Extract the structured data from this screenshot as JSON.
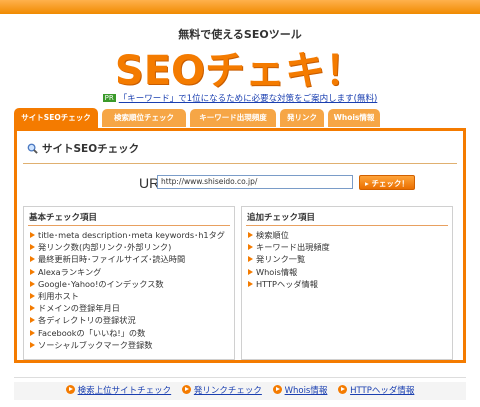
{
  "header": {
    "tagline": "無料で使えるSEOツール",
    "logo_text": "SEOチェキ！"
  },
  "notice": {
    "badge": "PR",
    "text": "「キーワード」で1位になるために必要な対策をご案内します(無料)"
  },
  "tabs": [
    {
      "label": "サイトSEOチェック",
      "active": true
    },
    {
      "label": "検索順位チェック",
      "active": false
    },
    {
      "label": "キーワード出現頻度",
      "active": false
    },
    {
      "label": "発リンク",
      "active": false
    },
    {
      "label": "Whois情報",
      "active": false
    }
  ],
  "panel": {
    "title": "サイトSEOチェック",
    "url_label": "URL",
    "url_value": "http://www.shiseido.co.jp/",
    "check_button": "チェック！"
  },
  "basic_check": {
    "title": "基本チェック項目",
    "items": [
      "title･meta description･meta keywords･h1タグ",
      "発リンク数(内部リンク･外部リンク)",
      "最終更新日時･ファイルサイズ･読込時間",
      "Alexaランキング",
      "Google･Yahoo!のインデックス数",
      "利用ホスト",
      "ドメインの登録年月日",
      "各ディレクトリの登録状況",
      "Facebookの「いいね!」の数",
      "ソーシャルブックマーク登録数"
    ]
  },
  "additional_check": {
    "title": "追加チェック項目",
    "items": [
      "検索順位",
      "キーワード出現頻度",
      "発リンク一覧",
      "Whois情報",
      "HTTPヘッダ情報"
    ]
  },
  "footer_links": [
    "検索上位サイトチェック",
    "発リンクチェック",
    "Whois情報",
    "HTTPヘッダ情報"
  ],
  "colors": {
    "accent": "#f47b00",
    "tab_inactive": "#f6a646",
    "link": "#1a3fb0",
    "pr_badge": "#3a9a2a"
  }
}
